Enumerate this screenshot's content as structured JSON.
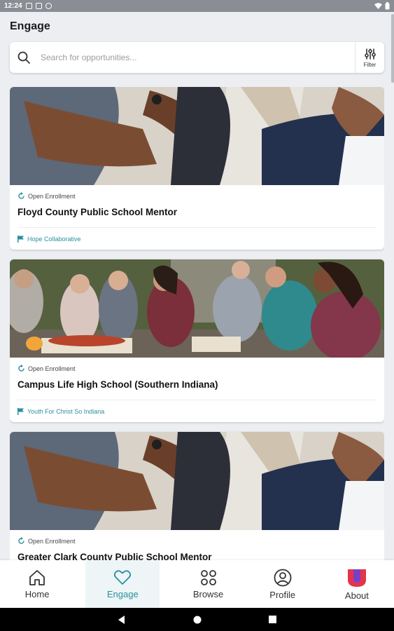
{
  "status_bar": {
    "time": "12:24"
  },
  "header": {
    "title": "Engage"
  },
  "search": {
    "placeholder": "Search for opportunities...",
    "filter_label": "Filter"
  },
  "cards": [
    {
      "status": "Open Enrollment",
      "title": "Floyd County Public School Mentor",
      "org": "Hope Collaborative"
    },
    {
      "status": "Open Enrollment",
      "title": "Campus Life High School (Southern Indiana)",
      "org": "Youth For Christ So Indiana"
    },
    {
      "status": "Open Enrollment",
      "title": "Greater Clark County Public School Mentor",
      "org": ""
    }
  ],
  "bottom_nav": {
    "items": [
      {
        "label": "Home",
        "icon": "home-icon"
      },
      {
        "label": "Engage",
        "icon": "heart-icon",
        "active": true
      },
      {
        "label": "Browse",
        "icon": "grid-icon"
      },
      {
        "label": "Profile",
        "icon": "person-icon"
      },
      {
        "label": "About",
        "icon": "u-logo-icon"
      }
    ]
  },
  "colors": {
    "accent": "#2a8fa0",
    "background": "#eceef2",
    "logo_red": "#e2354a",
    "logo_purple": "#7b3fc4"
  }
}
